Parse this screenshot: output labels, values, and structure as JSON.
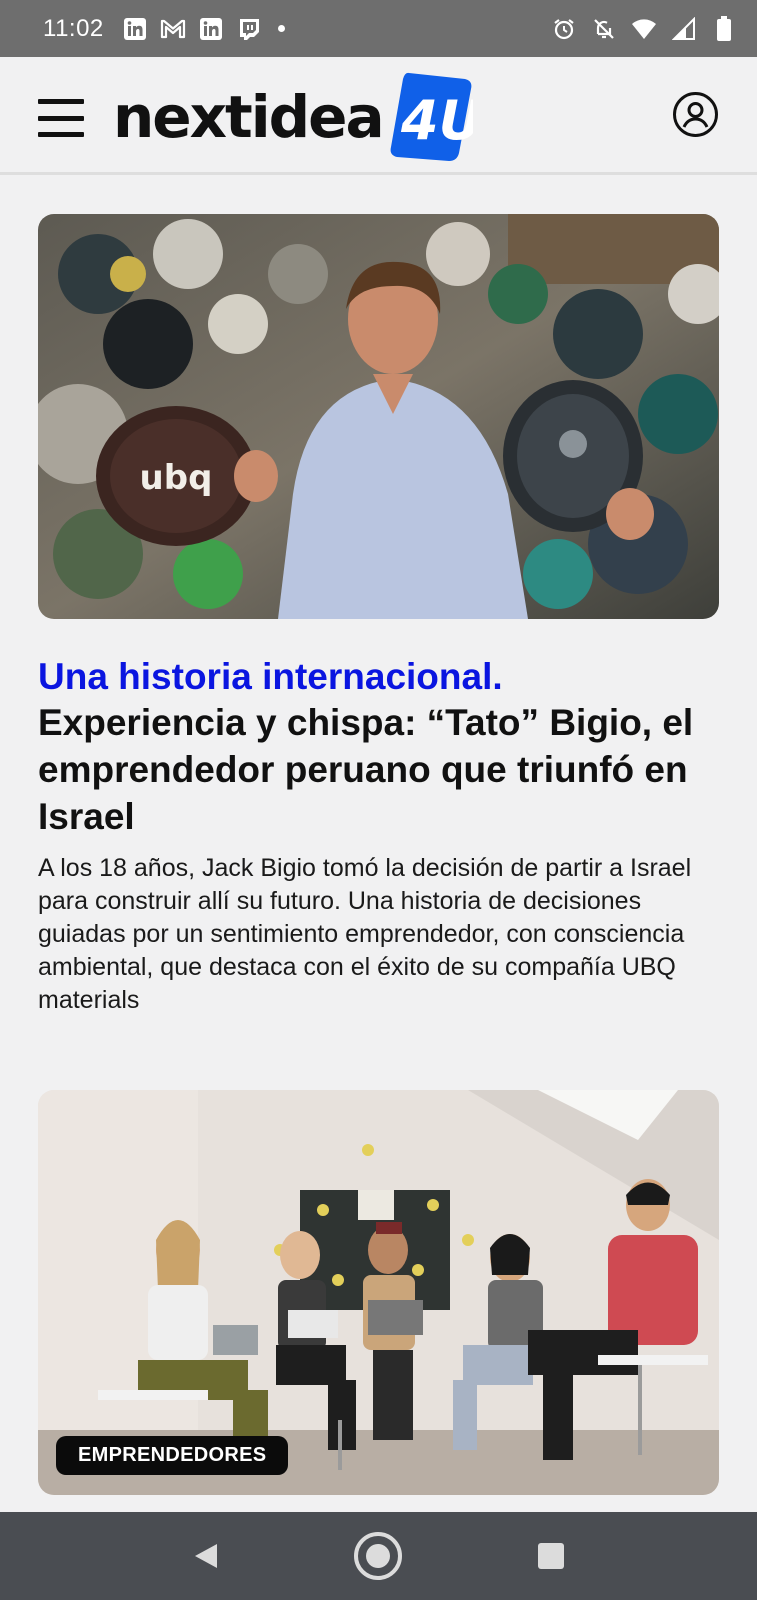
{
  "status_bar": {
    "time": "11:02",
    "left_icons": [
      "linkedin-icon",
      "gmail-icon",
      "linkedin-icon",
      "twitch-icon",
      "notification-dot"
    ],
    "right_icons": [
      "alarm-icon",
      "bell-off-icon",
      "wifi-icon",
      "cellular-signal-icon",
      "battery-icon"
    ]
  },
  "header": {
    "logo_text": "nextidea",
    "logo_mark_text": "4U",
    "brand_color": "#1060e8"
  },
  "articles": [
    {
      "kicker": "Una historia internacional.",
      "headline": "Experiencia y chispa: “Tato” Bigio, el emprendedor peruano que triunfó en Israel",
      "summary": "A los 18 años, Jack Bigio tomó la decisión de partir a Israel para construir allí su futuro. Una historia de decisiones guiadas por un sentimiento emprendedor, con consciencia ambiental, que destaca con el éxito de su compañía UBQ materials",
      "image_text": "ubq"
    },
    {
      "badge": "EMPRENDEDORES"
    }
  ],
  "colors": {
    "kicker": "#0a15e0",
    "status_bar_bg": "#6e6e6e",
    "nav_bar_bg": "#4a4d52"
  }
}
